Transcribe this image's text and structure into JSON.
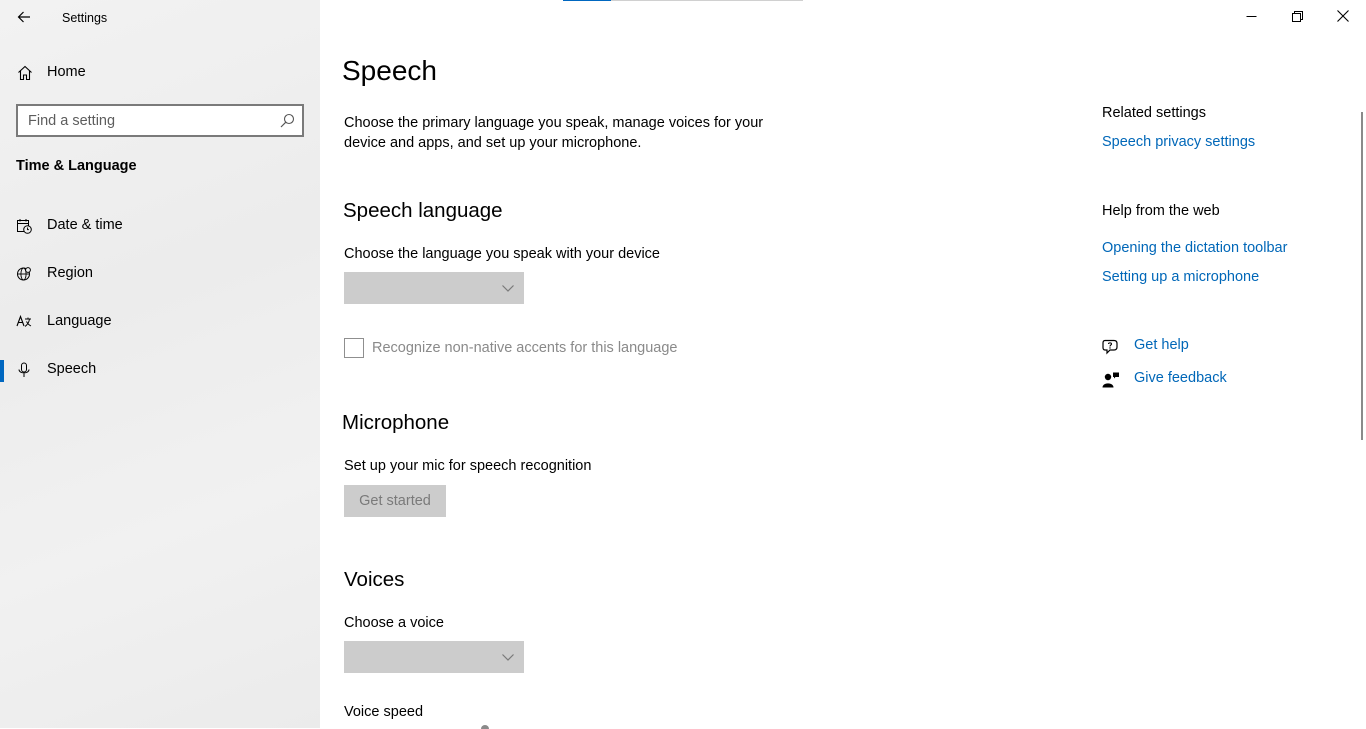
{
  "app": {
    "title": "Settings"
  },
  "sidebar": {
    "home_label": "Home",
    "search_placeholder": "Find a setting",
    "section_title": "Time & Language",
    "items": [
      {
        "label": "Date & time",
        "icon": "date-time-icon",
        "active": false
      },
      {
        "label": "Region",
        "icon": "region-icon",
        "active": false
      },
      {
        "label": "Language",
        "icon": "language-icon",
        "active": false
      },
      {
        "label": "Speech",
        "icon": "microphone-icon",
        "active": true
      }
    ]
  },
  "main": {
    "title": "Speech",
    "intro": "Choose the primary language you speak, manage voices for your device and apps, and set up your microphone.",
    "speech_language": {
      "heading": "Speech language",
      "prompt": "Choose the language you speak with your device",
      "dropdown_value": "",
      "checkbox_label": "Recognize non-native accents for this language",
      "checkbox_checked": false
    },
    "microphone": {
      "heading": "Microphone",
      "prompt": "Set up your mic for speech recognition",
      "button_label": "Get started"
    },
    "voices": {
      "heading": "Voices",
      "prompt": "Choose a voice",
      "dropdown_value": "",
      "speed_label": "Voice speed"
    }
  },
  "right_column": {
    "related_heading": "Related settings",
    "related_link": "Speech privacy settings",
    "help_heading": "Help from the web",
    "help_links": [
      "Opening the dictation toolbar",
      "Setting up a microphone"
    ],
    "get_help": "Get help",
    "give_feedback": "Give feedback"
  },
  "colors": {
    "accent": "#0067c0",
    "link": "#0067b8",
    "disabled_fill": "#cccccc",
    "sidebar_bg": "#efefef"
  }
}
